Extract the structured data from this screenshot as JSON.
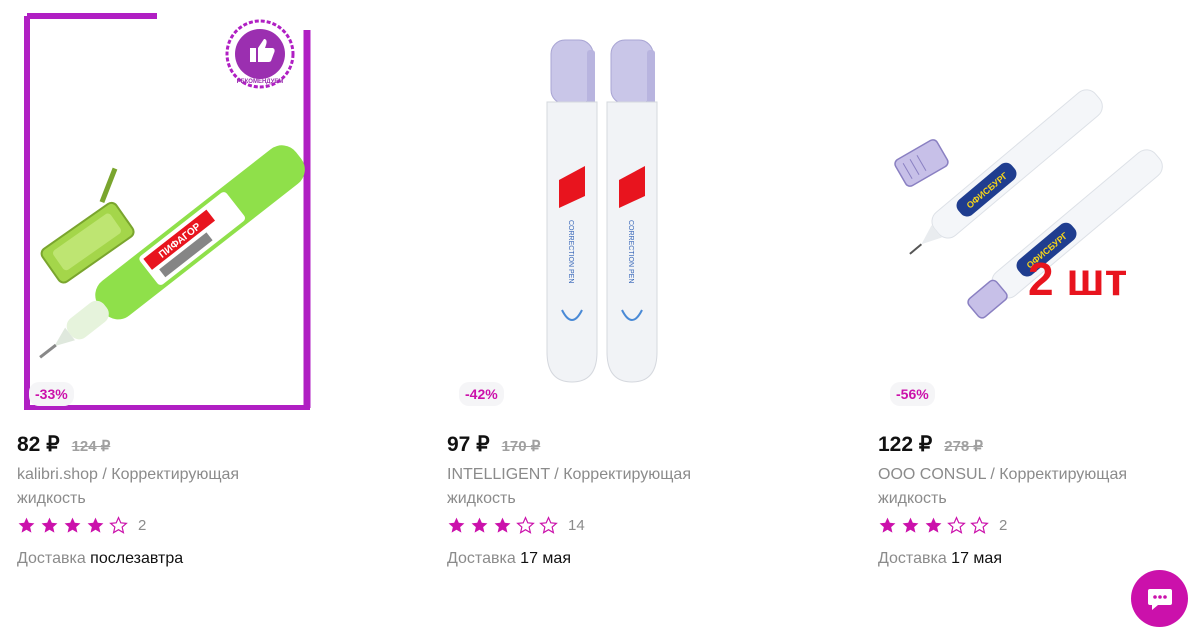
{
  "products": [
    {
      "discount": "-33%",
      "price": "82 ₽",
      "old_price": "124 ₽",
      "brand": "kalibri.shop",
      "separator": " / ",
      "name": "Корректирующая жидкость",
      "rating_stars": 4,
      "reviews": "2",
      "delivery_label": "Доставка",
      "delivery_date": "послезавтра",
      "badge_icon": "thumbs-up-icon",
      "badge_text": "РЕКОМЕНДУЕМ",
      "pen_brand": "ПИФАГОР"
    },
    {
      "discount": "-42%",
      "price": "97 ₽",
      "old_price": "170 ₽",
      "brand": "INTELLIGENT",
      "separator": " / ",
      "name": "Корректирующая жидкость",
      "rating_stars": 3,
      "reviews": "14",
      "delivery_label": "Доставка",
      "delivery_date": "17 мая",
      "pen_label": "CORRECTION PEN"
    },
    {
      "discount": "-56%",
      "price": "122 ₽",
      "old_price": "278 ₽",
      "brand": "ООО CONSUL",
      "separator": " / ",
      "name": "Корректирующая жидкость",
      "rating_stars": 3,
      "reviews": "2",
      "delivery_label": "Доставка",
      "delivery_date": "17 мая",
      "promo_text": "2 шт",
      "pen_brand": "ОФИСБУРГ"
    }
  ],
  "colors": {
    "accent": "#cb11ab",
    "discount_bg": "#f5f5f7",
    "muted_text": "#8b8b8b",
    "promo_red": "#e8141e"
  },
  "icons": {
    "star_filled": "star-filled-icon",
    "star_empty": "star-empty-icon",
    "chat": "chat-bubble-icon"
  }
}
